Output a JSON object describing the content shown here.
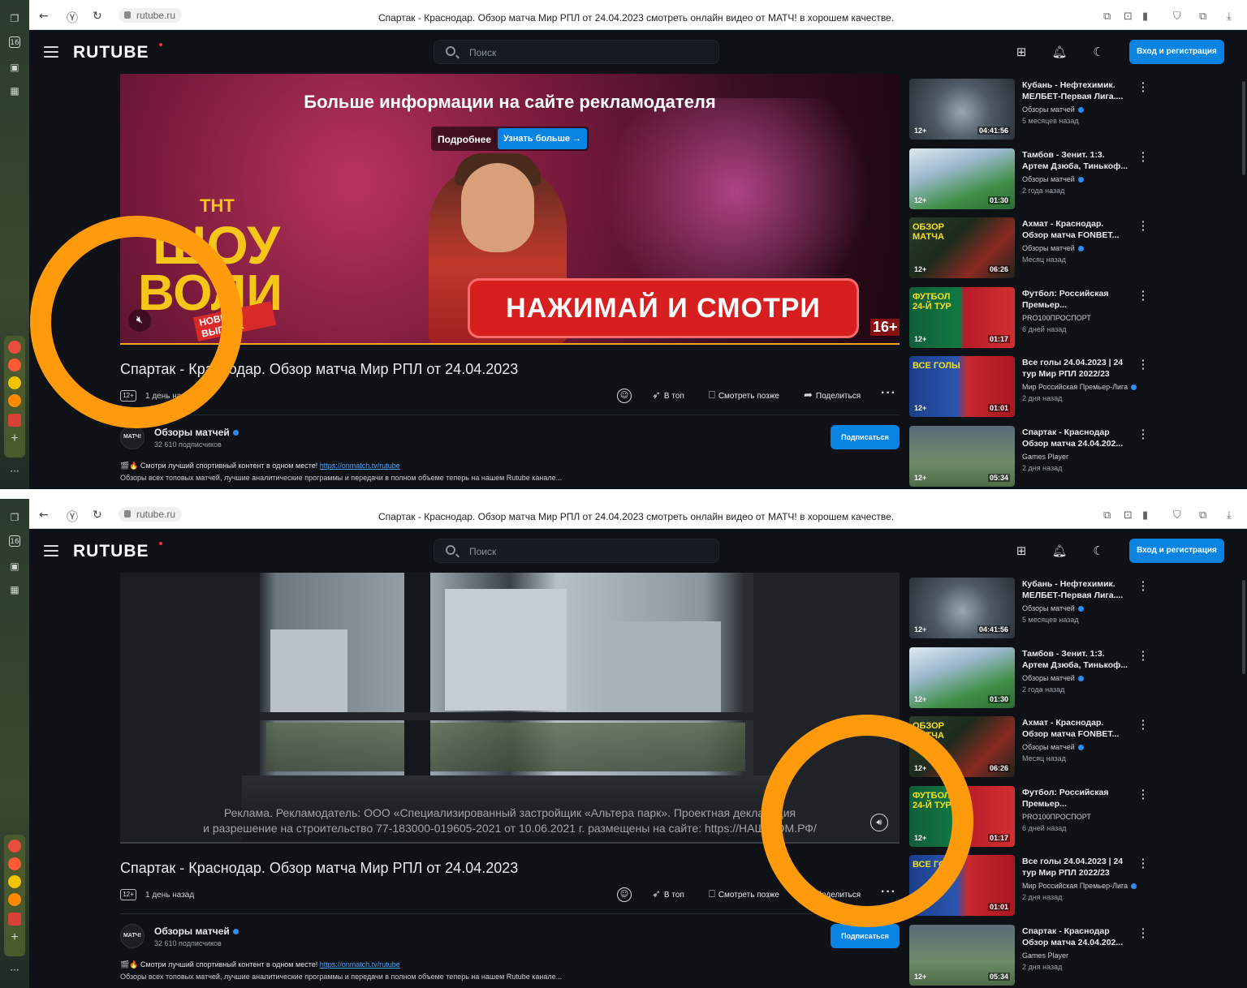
{
  "browser": {
    "url": "rutube.ru",
    "page_title": "Спартак - Краснодар. Обзор матча Мир РПЛ от 24.04.2023 смотреть онлайн видео от МАТЧ! в хорошем качестве."
  },
  "os_sidebar": {
    "badge": "16"
  },
  "header": {
    "logo": "RUTUBE",
    "search_placeholder": "Поиск",
    "login_label": "Вход и регистрация"
  },
  "ad_top": {
    "headline": "Больше информации на сайте рекламодателя",
    "more_label": "Подробнее",
    "learn_label": "Узнать больше →",
    "show_channel": "ТНТ",
    "show_name_1": "ШОУ",
    "show_name_2": "ВОЛИ",
    "show_tag": "НОВЫЙ ВЫПУСК",
    "cta": "НАЖИМАЙ И СМОТРИ",
    "age_rating": "16+"
  },
  "ad_bottom": {
    "legal_line_1": "Реклама. Рекламодатель: ООО «Специализированный застройщик «Альтера парк». Проектная декларация",
    "legal_line_2": "и разрешение на строительство 77-183000-019605-2021 от 10.06.2021 г. размещены на сайте: https://НАШ.ДОМ.РФ/"
  },
  "video": {
    "title": "Спартак - Краснодар. Обзор матча Мир РПЛ от 24.04.2023",
    "age": "12+",
    "date": "1 день назад",
    "actions": {
      "top": "В топ",
      "later": "Смотреть позже",
      "share": "Поделиться"
    }
  },
  "channel": {
    "avatar_text": "МАТЧ!",
    "name": "Обзоры матчей",
    "subscribers": "32 610 подписчиков",
    "subscribe_label": "Подписаться"
  },
  "description": {
    "line1_prefix": "🎬🔥 Смотри лучший спортивный контент в одном месте!",
    "link": "https://onmatch.tv/rutube",
    "line2": "Обзоры всех топовых матчей, лучшие аналитические программы и передачи в полном объеме теперь на нашем Rutube канале..."
  },
  "recommendations": [
    {
      "title": "Кубань - Нефтехимик.\nМЕЛБЕТ-Первая Лига....",
      "channel": "Обзоры матчей",
      "verified": true,
      "date": "5 месяцев назад",
      "duration": "04:41:56",
      "age": "12+",
      "overlay": "",
      "theme": "stadium"
    },
    {
      "title": "Тамбов - Зенит. 1:3.\nАртем Дзюба, Тинькоф...",
      "channel": "Обзоры матчей",
      "verified": true,
      "date": "2 года назад",
      "duration": "01:30",
      "age": "12+",
      "overlay": "",
      "theme": "green"
    },
    {
      "title": "Ахмат - Краснодар.\nОбзор матча FONBET...",
      "channel": "Обзоры матчей",
      "verified": true,
      "date": "Месяц назад",
      "duration": "06:26",
      "age": "12+",
      "overlay": "ОБЗОР\nМАТЧА",
      "theme": "dark"
    },
    {
      "title": "Футбол: Российская\nПремьер...",
      "channel": "PRO100ПРОСПОРТ",
      "verified": false,
      "date": "6 дней назад",
      "duration": "01:17",
      "age": "12+",
      "overlay": "ФУТБОЛ\n24-Й ТУР",
      "theme": "futbol"
    },
    {
      "title": "Все голы 24.04.2023 | 24\nтур Мир РПЛ 2022/23",
      "channel": "Мир Российская Премьер-Лига",
      "verified": true,
      "date": "2 дня назад",
      "duration": "01:01",
      "age": "12+",
      "overlay": "ВСЕ ГОЛЫ",
      "theme": "goals"
    },
    {
      "title": "Спартак - Краснодар\nОбзор матча 24.04.202...",
      "channel": "Games Player",
      "verified": false,
      "date": "2 дня назад",
      "duration": "05:34",
      "age": "12+",
      "overlay": "",
      "theme": "arena"
    }
  ]
}
